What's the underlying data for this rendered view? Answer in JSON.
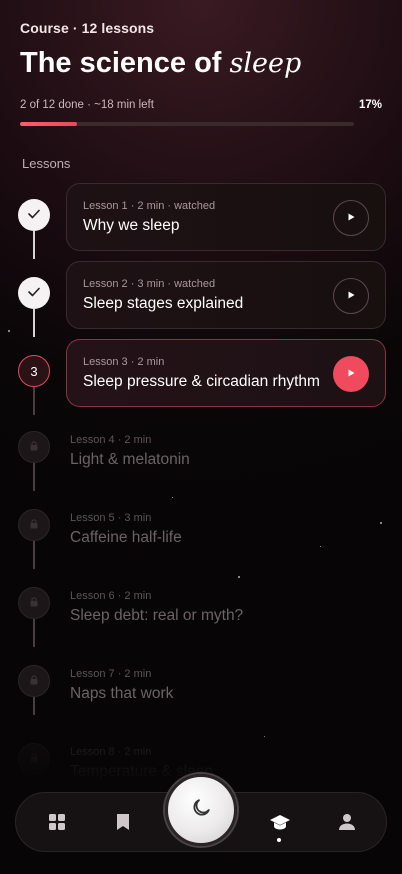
{
  "course": {
    "kicker": "Course · 12 lessons",
    "title_plain": "The science of",
    "title_italic": "sleep"
  },
  "progress": {
    "label": "2 of 12 done · ~18 min left",
    "percent_text": "17%",
    "fraction": 0.17
  },
  "section_label": "Lessons",
  "lessons": [
    {
      "node": "done",
      "meta": "Lesson 1 · 2 min · watched",
      "title": "Why we sleep"
    },
    {
      "node": "done",
      "meta": "Lesson 2 · 3 min · watched",
      "title": "Sleep stages explained"
    },
    {
      "node": "current",
      "number": "3",
      "meta": "Lesson 3 · 2 min",
      "title": "Sleep pressure & circadian rhythm"
    },
    {
      "node": "locked",
      "meta": "Lesson 4 · 2 min",
      "title": "Light & melatonin"
    },
    {
      "node": "locked",
      "meta": "Lesson 5 · 3 min",
      "title": "Caffeine half-life"
    },
    {
      "node": "locked",
      "meta": "Lesson 6 · 2 min",
      "title": "Sleep debt: real or myth?"
    },
    {
      "node": "locked",
      "meta": "Lesson 7 · 2 min",
      "title": "Naps that work"
    },
    {
      "node": "locked",
      "meta": "Lesson 8 · 2 min",
      "title": "Temperature & sleep"
    }
  ],
  "nav": {
    "items": [
      "grid-icon",
      "bookmark-icon",
      "moon-icon",
      "graduation-cap-icon",
      "user-icon"
    ],
    "active": "graduation-cap-icon"
  },
  "colors": {
    "accent": "#ef4a5e",
    "background": "#0a0608"
  }
}
